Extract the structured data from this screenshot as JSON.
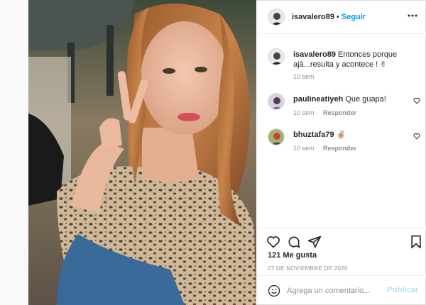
{
  "post": {
    "username": "isavalero89",
    "separator": "•",
    "follow_label": "Seguir",
    "more_icon": "more-horizontal-icon"
  },
  "comments": [
    {
      "username": "isavalero89",
      "text": "Entonces porque ajá...resulta y acontece ! ✌",
      "time": "10 sem",
      "reply": ""
    },
    {
      "username": "paulineatiyeh",
      "text": "Que guapa!",
      "time": "10 sem",
      "reply": "Responder"
    },
    {
      "username": "bhuztafa79",
      "text": "✌🏼",
      "time": "10 sem",
      "reply": "Responder"
    }
  ],
  "actions": {
    "likes": "121 Me gusta",
    "date": "27 DE NOVIEMBRE DE 2020"
  },
  "add_comment": {
    "placeholder": "Agrega un comentario...",
    "publish_label": "Publicar"
  },
  "colors": {
    "accent": "#0095f6",
    "publish_disabled": "#b2dffc",
    "muted": "#8e8e8e"
  }
}
